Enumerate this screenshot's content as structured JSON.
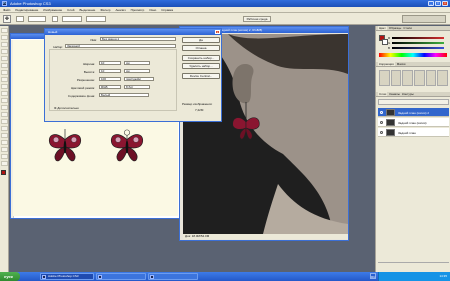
{
  "app": {
    "title": "Adobe Photoshop CS3",
    "logo": "Ps"
  },
  "window_controls": {
    "minimize": "_",
    "maximize": "□",
    "close": "x"
  },
  "menu": [
    "Файл",
    "Редактирование",
    "Изображение",
    "Слой",
    "Выделение",
    "Фильтр",
    "Анализ",
    "Просмотр",
    "Окно",
    "Справка"
  ],
  "options_bar": {
    "tool_icon": "move-tool-icon",
    "workspace_button": "Рабочая среда"
  },
  "document_top": {
    "title": "DSCF0036.JPG @ 25.6% (Задний план (копия) 2, RGB/8)",
    "status": "Док: 18.0M/54.0M"
  },
  "document_left": {
    "title": ""
  },
  "dialog": {
    "title": "Новый",
    "close": "x",
    "name_label": "Имя:",
    "name_value": "Без имени-1",
    "preset_label": "Набор:",
    "preset_value": "Заказной",
    "width_label": "Ширина:",
    "width_value": "10",
    "width_unit": "см",
    "height_label": "Высота:",
    "height_value": "10",
    "height_unit": "см",
    "resolution_label": "Разрешение:",
    "resolution_value": "100",
    "resolution_unit": "пикс/дюйм",
    "color_mode_label": "Цветовой режим:",
    "color_mode_value": "RGB",
    "bit_depth_value": "8 бит",
    "background_label": "Содержимое фона:",
    "background_value": "Белый",
    "advanced_label": "Дополнительно",
    "buttons": [
      "Да",
      "Отмена",
      "Сохранить набор...",
      "Удалить набор...",
      "Device Central..."
    ],
    "image_size_label": "Размер изображения:",
    "image_size_value": "7,22M"
  },
  "right_panel": {
    "color_tabs": [
      "Цвет",
      "Образцы",
      "Стили"
    ],
    "color_sliders": [
      {
        "label": "R",
        "color": "#d33030"
      },
      {
        "label": "G",
        "color": "#3fae3f"
      },
      {
        "label": "B",
        "color": "#3a4fd6"
      }
    ],
    "foreground_color": "#b01212",
    "background_color": "#ffffff",
    "adjust_tabs": [
      "Коррекция",
      "Маски"
    ],
    "layers_tabs": [
      "Слои",
      "Каналы",
      "Контуры"
    ],
    "layers": [
      {
        "name": "Задний план (копия) 2",
        "active": true
      },
      {
        "name": "Задний план (копия)",
        "active": false
      },
      {
        "name": "Задний план",
        "active": false
      }
    ]
  },
  "taskbar": {
    "start_label": "пуск",
    "tasks": [
      {
        "label": "Adobe Photoshop CS3",
        "active": true
      },
      {
        "label": "",
        "active": false
      },
      {
        "label": "",
        "active": false
      }
    ],
    "lang": "RU",
    "clock": "14:35"
  }
}
